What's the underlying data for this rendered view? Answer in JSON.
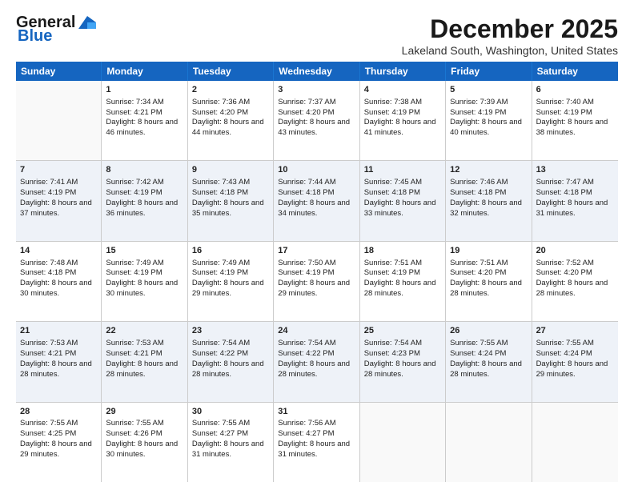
{
  "header": {
    "logo_line1": "General",
    "logo_line2": "Blue",
    "month": "December 2025",
    "location": "Lakeland South, Washington, United States"
  },
  "days": [
    "Sunday",
    "Monday",
    "Tuesday",
    "Wednesday",
    "Thursday",
    "Friday",
    "Saturday"
  ],
  "rows": [
    [
      {
        "day": "",
        "sunrise": "",
        "sunset": "",
        "daylight": ""
      },
      {
        "day": "1",
        "sunrise": "Sunrise: 7:34 AM",
        "sunset": "Sunset: 4:21 PM",
        "daylight": "Daylight: 8 hours and 46 minutes."
      },
      {
        "day": "2",
        "sunrise": "Sunrise: 7:36 AM",
        "sunset": "Sunset: 4:20 PM",
        "daylight": "Daylight: 8 hours and 44 minutes."
      },
      {
        "day": "3",
        "sunrise": "Sunrise: 7:37 AM",
        "sunset": "Sunset: 4:20 PM",
        "daylight": "Daylight: 8 hours and 43 minutes."
      },
      {
        "day": "4",
        "sunrise": "Sunrise: 7:38 AM",
        "sunset": "Sunset: 4:19 PM",
        "daylight": "Daylight: 8 hours and 41 minutes."
      },
      {
        "day": "5",
        "sunrise": "Sunrise: 7:39 AM",
        "sunset": "Sunset: 4:19 PM",
        "daylight": "Daylight: 8 hours and 40 minutes."
      },
      {
        "day": "6",
        "sunrise": "Sunrise: 7:40 AM",
        "sunset": "Sunset: 4:19 PM",
        "daylight": "Daylight: 8 hours and 38 minutes."
      }
    ],
    [
      {
        "day": "7",
        "sunrise": "Sunrise: 7:41 AM",
        "sunset": "Sunset: 4:19 PM",
        "daylight": "Daylight: 8 hours and 37 minutes."
      },
      {
        "day": "8",
        "sunrise": "Sunrise: 7:42 AM",
        "sunset": "Sunset: 4:19 PM",
        "daylight": "Daylight: 8 hours and 36 minutes."
      },
      {
        "day": "9",
        "sunrise": "Sunrise: 7:43 AM",
        "sunset": "Sunset: 4:18 PM",
        "daylight": "Daylight: 8 hours and 35 minutes."
      },
      {
        "day": "10",
        "sunrise": "Sunrise: 7:44 AM",
        "sunset": "Sunset: 4:18 PM",
        "daylight": "Daylight: 8 hours and 34 minutes."
      },
      {
        "day": "11",
        "sunrise": "Sunrise: 7:45 AM",
        "sunset": "Sunset: 4:18 PM",
        "daylight": "Daylight: 8 hours and 33 minutes."
      },
      {
        "day": "12",
        "sunrise": "Sunrise: 7:46 AM",
        "sunset": "Sunset: 4:18 PM",
        "daylight": "Daylight: 8 hours and 32 minutes."
      },
      {
        "day": "13",
        "sunrise": "Sunrise: 7:47 AM",
        "sunset": "Sunset: 4:18 PM",
        "daylight": "Daylight: 8 hours and 31 minutes."
      }
    ],
    [
      {
        "day": "14",
        "sunrise": "Sunrise: 7:48 AM",
        "sunset": "Sunset: 4:18 PM",
        "daylight": "Daylight: 8 hours and 30 minutes."
      },
      {
        "day": "15",
        "sunrise": "Sunrise: 7:49 AM",
        "sunset": "Sunset: 4:19 PM",
        "daylight": "Daylight: 8 hours and 30 minutes."
      },
      {
        "day": "16",
        "sunrise": "Sunrise: 7:49 AM",
        "sunset": "Sunset: 4:19 PM",
        "daylight": "Daylight: 8 hours and 29 minutes."
      },
      {
        "day": "17",
        "sunrise": "Sunrise: 7:50 AM",
        "sunset": "Sunset: 4:19 PM",
        "daylight": "Daylight: 8 hours and 29 minutes."
      },
      {
        "day": "18",
        "sunrise": "Sunrise: 7:51 AM",
        "sunset": "Sunset: 4:19 PM",
        "daylight": "Daylight: 8 hours and 28 minutes."
      },
      {
        "day": "19",
        "sunrise": "Sunrise: 7:51 AM",
        "sunset": "Sunset: 4:20 PM",
        "daylight": "Daylight: 8 hours and 28 minutes."
      },
      {
        "day": "20",
        "sunrise": "Sunrise: 7:52 AM",
        "sunset": "Sunset: 4:20 PM",
        "daylight": "Daylight: 8 hours and 28 minutes."
      }
    ],
    [
      {
        "day": "21",
        "sunrise": "Sunrise: 7:53 AM",
        "sunset": "Sunset: 4:21 PM",
        "daylight": "Daylight: 8 hours and 28 minutes."
      },
      {
        "day": "22",
        "sunrise": "Sunrise: 7:53 AM",
        "sunset": "Sunset: 4:21 PM",
        "daylight": "Daylight: 8 hours and 28 minutes."
      },
      {
        "day": "23",
        "sunrise": "Sunrise: 7:54 AM",
        "sunset": "Sunset: 4:22 PM",
        "daylight": "Daylight: 8 hours and 28 minutes."
      },
      {
        "day": "24",
        "sunrise": "Sunrise: 7:54 AM",
        "sunset": "Sunset: 4:22 PM",
        "daylight": "Daylight: 8 hours and 28 minutes."
      },
      {
        "day": "25",
        "sunrise": "Sunrise: 7:54 AM",
        "sunset": "Sunset: 4:23 PM",
        "daylight": "Daylight: 8 hours and 28 minutes."
      },
      {
        "day": "26",
        "sunrise": "Sunrise: 7:55 AM",
        "sunset": "Sunset: 4:24 PM",
        "daylight": "Daylight: 8 hours and 28 minutes."
      },
      {
        "day": "27",
        "sunrise": "Sunrise: 7:55 AM",
        "sunset": "Sunset: 4:24 PM",
        "daylight": "Daylight: 8 hours and 29 minutes."
      }
    ],
    [
      {
        "day": "28",
        "sunrise": "Sunrise: 7:55 AM",
        "sunset": "Sunset: 4:25 PM",
        "daylight": "Daylight: 8 hours and 29 minutes."
      },
      {
        "day": "29",
        "sunrise": "Sunrise: 7:55 AM",
        "sunset": "Sunset: 4:26 PM",
        "daylight": "Daylight: 8 hours and 30 minutes."
      },
      {
        "day": "30",
        "sunrise": "Sunrise: 7:55 AM",
        "sunset": "Sunset: 4:27 PM",
        "daylight": "Daylight: 8 hours and 31 minutes."
      },
      {
        "day": "31",
        "sunrise": "Sunrise: 7:56 AM",
        "sunset": "Sunset: 4:27 PM",
        "daylight": "Daylight: 8 hours and 31 minutes."
      },
      {
        "day": "",
        "sunrise": "",
        "sunset": "",
        "daylight": ""
      },
      {
        "day": "",
        "sunrise": "",
        "sunset": "",
        "daylight": ""
      },
      {
        "day": "",
        "sunrise": "",
        "sunset": "",
        "daylight": ""
      }
    ]
  ]
}
